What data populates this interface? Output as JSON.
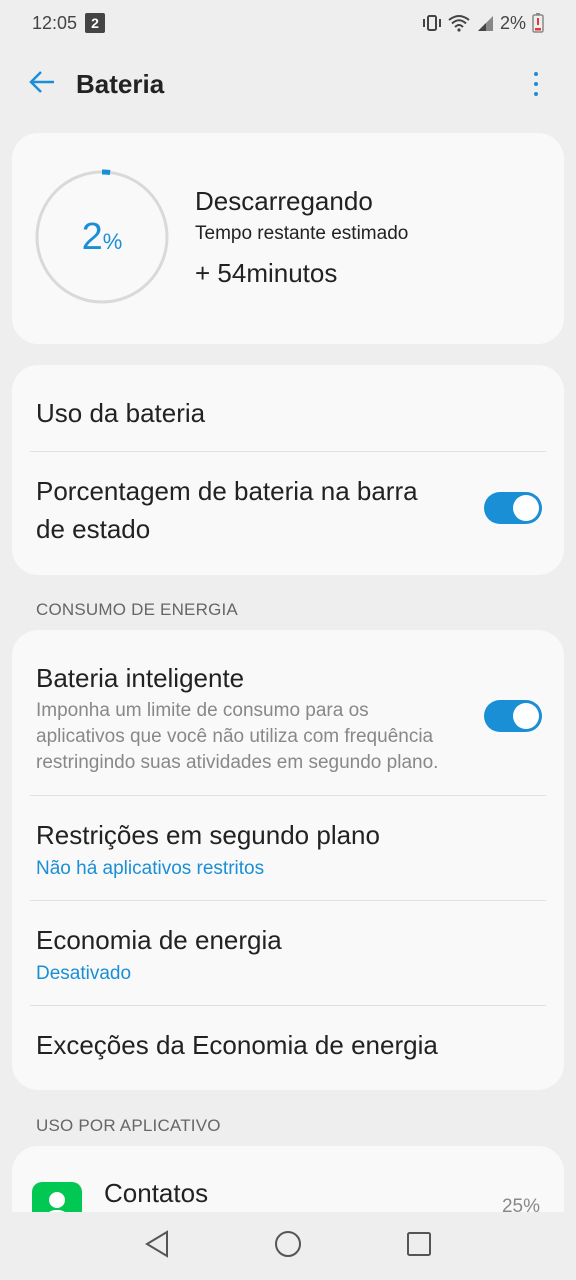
{
  "status_bar": {
    "time": "12:05",
    "notification_badge": "2",
    "battery_text": "2%"
  },
  "app_bar": {
    "title": "Bateria"
  },
  "battery": {
    "level_percent": 2,
    "level_number": "2",
    "percent_sign": "%",
    "status": "Descarregando",
    "remaining_label": "Tempo restante estimado",
    "remaining_value": "+ 54minutos"
  },
  "settings_top": {
    "usage": "Uso da bateria",
    "percentage_line1": "Porcentagem de bateria na barra",
    "percentage_line2": "de estado",
    "percentage_enabled": true
  },
  "energy_section": {
    "header": "CONSUMO DE ENERGIA",
    "smart_battery_title": "Bateria inteligente",
    "smart_battery_desc_1": "Imponha um limite de consumo para os",
    "smart_battery_desc_2": "aplicativos que você não utiliza com frequência",
    "smart_battery_desc_3": "restringindo suas atividades em segundo plano.",
    "smart_battery_enabled": true,
    "background_title": "Restrições em segundo plano",
    "background_sub": "Não há aplicativos restritos",
    "saver_title": "Economia de energia",
    "saver_sub": "Desativado",
    "exceptions_title": "Exceções da Economia de energia"
  },
  "app_section": {
    "header": "USO POR APLICATIVO",
    "apps": [
      {
        "name": "Contatos",
        "percent": "25%"
      }
    ]
  },
  "colors": {
    "accent": "#1a8fd6",
    "background": "#eeeeee",
    "card": "#f9f9f9",
    "contacts_icon": "#00c853"
  }
}
